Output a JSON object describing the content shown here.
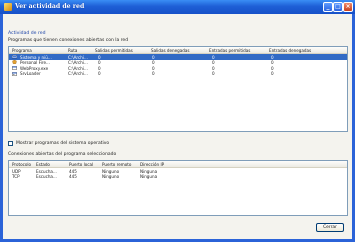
{
  "window": {
    "title": "Ver actividad de red",
    "controls": {
      "minimize": "_",
      "maximize": "□",
      "close": "×"
    }
  },
  "section_title": "Actividad de red",
  "programs": {
    "label": "Programas que tienen conexiones abiertas con la red",
    "columns": [
      "Programa",
      "Ruta",
      "Salidas permitidas",
      "Salidas denegadas",
      "Entradas permitidas",
      "Entradas denegadas"
    ],
    "rows": [
      {
        "icon": "system-icon",
        "name": "Sistema y niü...",
        "path": "C:\\Archi...",
        "out_allowed": "0",
        "out_denied": "0",
        "in_allowed": "0",
        "in_denied": "0",
        "selected": true
      },
      {
        "icon": "firewall-icon",
        "name": "Personal Fire...",
        "path": "C:\\Archi...",
        "out_allowed": "0",
        "out_denied": "0",
        "in_allowed": "0",
        "in_denied": "0",
        "selected": false
      },
      {
        "icon": "proxy-icon",
        "name": "WebProxy.exe",
        "path": "C:\\Archi...",
        "out_allowed": "0",
        "out_denied": "0",
        "in_allowed": "0",
        "in_denied": "0",
        "selected": false
      },
      {
        "icon": "loader-icon",
        "name": "SrvLoader",
        "path": "C:\\Archi...",
        "out_allowed": "0",
        "out_denied": "0",
        "in_allowed": "0",
        "in_denied": "0",
        "selected": false
      }
    ]
  },
  "show_system": {
    "label": "Mostrar programas del sistema operativo",
    "checked": false
  },
  "connections": {
    "label": "Conexiones abiertas del programa seleccionado",
    "columns": [
      "Protocolo",
      "Estado",
      "Puerto local",
      "Puerto remoto",
      "Dirección IP"
    ],
    "rows": [
      {
        "protocol": "UDP",
        "state": "Escucha...",
        "local_port": "445",
        "remote_port": "Ninguno",
        "ip": "Ninguna"
      },
      {
        "protocol": "TCP",
        "state": "Escucha...",
        "local_port": "445",
        "remote_port": "Ninguno",
        "ip": "Ninguna"
      }
    ]
  },
  "close_button": "Cerrar",
  "colors": {
    "titlebar": "#1e5fd6",
    "selection": "#316ac5",
    "section_title": "#1c44a8"
  }
}
